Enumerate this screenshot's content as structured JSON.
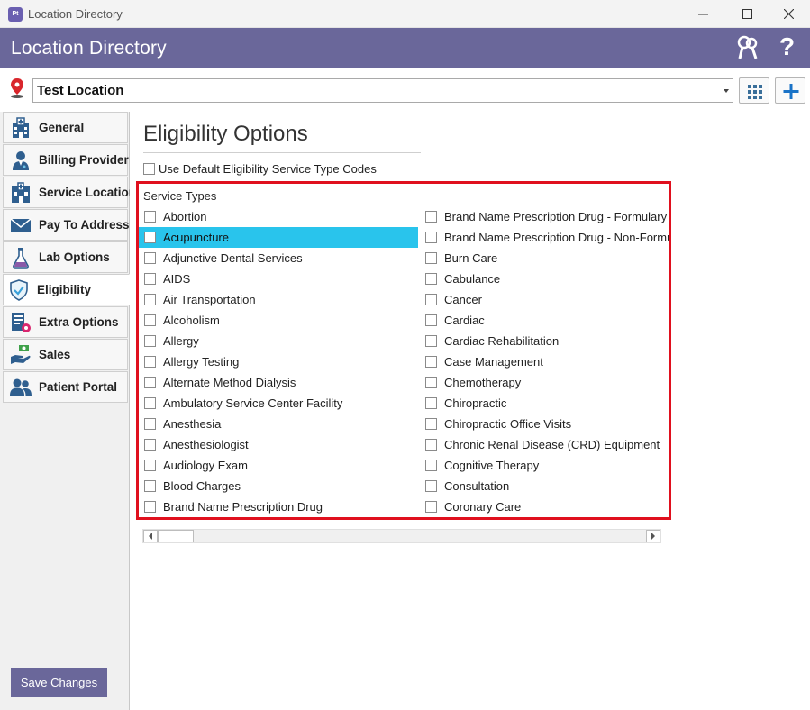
{
  "window": {
    "title": "Location Directory",
    "app_icon_text": "Pt"
  },
  "header": {
    "title": "Location Directory",
    "help_label": "?"
  },
  "location": {
    "selected": "Test Location"
  },
  "sidebar": {
    "items": [
      {
        "label": "General",
        "icon": "hospital-icon",
        "active": false
      },
      {
        "label": "Billing Provider",
        "icon": "doctor-icon",
        "active": false
      },
      {
        "label": "Service Location",
        "icon": "clinic-icon",
        "active": false
      },
      {
        "label": "Pay To Address",
        "icon": "envelope-icon",
        "active": false
      },
      {
        "label": "Lab Options",
        "icon": "flask-icon",
        "active": false
      },
      {
        "label": "Eligibility",
        "icon": "shield-check-icon",
        "active": true
      },
      {
        "label": "Extra Options",
        "icon": "settings-list-icon",
        "active": false
      },
      {
        "label": "Sales",
        "icon": "money-hand-icon",
        "active": false
      },
      {
        "label": "Patient Portal",
        "icon": "users-icon",
        "active": false
      }
    ],
    "save_label": "Save Changes"
  },
  "main": {
    "section_title": "Eligibility Options",
    "default_checkbox_label": "Use Default Eligibility Service Type Codes",
    "service_types_heading": "Service Types",
    "column1": [
      "Abortion",
      "Acupuncture",
      "Adjunctive Dental Services",
      "AIDS",
      "Air Transportation",
      "Alcoholism",
      "Allergy",
      "Allergy Testing",
      "Alternate Method Dialysis",
      "Ambulatory Service Center Facility",
      "Anesthesia",
      "Anesthesiologist",
      "Audiology Exam",
      "Blood Charges",
      "Brand Name Prescription Drug"
    ],
    "column2": [
      "Brand Name Prescription Drug - Formulary",
      "Brand Name Prescription Drug - Non-Formulary",
      "Burn Care",
      "Cabulance",
      "Cancer",
      "Cardiac",
      "Cardiac Rehabilitation",
      "Case Management",
      "Chemotherapy",
      "Chiropractic",
      "Chiropractic Office Visits",
      "Chronic Renal Disease (CRD) Equipment",
      "Cognitive Therapy",
      "Consultation",
      "Coronary Care"
    ],
    "selected_item": "Acupuncture"
  },
  "colors": {
    "header_bg": "#6a679a",
    "selection": "#29c4ec",
    "highlight_border": "#e0101e",
    "accent_blue": "#1a73c7"
  }
}
